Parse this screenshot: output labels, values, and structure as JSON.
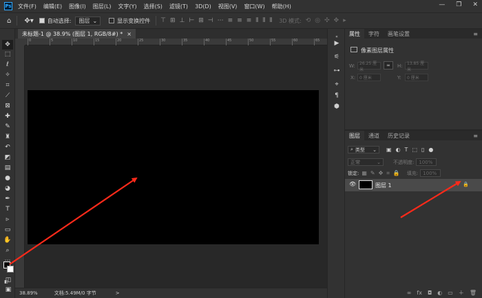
{
  "menubar": {
    "logo": "Ps",
    "items": [
      "文件(F)",
      "编辑(E)",
      "图像(I)",
      "图层(L)",
      "文字(Y)",
      "选择(S)",
      "滤镜(T)",
      "3D(D)",
      "视图(V)",
      "窗口(W)",
      "帮助(H)"
    ],
    "window_controls": [
      "—",
      "❐",
      "✕"
    ]
  },
  "options": {
    "auto_select_label": "自动选择:",
    "auto_select_value": "图层",
    "show_transform_label": "显示变换控件",
    "mode_3d_label": "3D 模式:"
  },
  "document": {
    "tab_title": "未标题-1 @ 38.9% (图层 1, RGB/8#) *",
    "close": "×"
  },
  "ruler": {
    "top_ticks": [
      "0",
      "5",
      "10",
      "15",
      "20",
      "25",
      "30",
      "35",
      "40",
      "45",
      "50",
      "55",
      "60",
      "65"
    ]
  },
  "status": {
    "zoom": "38.89%",
    "doc_info": "文档:5.49M/0 字节",
    "arrow": ">"
  },
  "properties": {
    "tabs": [
      "属性",
      "字符",
      "画笔设置"
    ],
    "section_title": "像素图层属性",
    "w_label": "W:",
    "w_value": "26.25 厘米",
    "h_label": "H:",
    "h_value": "13.85 厘米",
    "x_label": "X:",
    "x_value": "0 厘米",
    "y_label": "Y:",
    "y_value": "0 厘米"
  },
  "layers": {
    "tabs": [
      "图层",
      "通道",
      "历史记录"
    ],
    "filter_kind": "类型",
    "blend_mode": "正常",
    "opacity_label": "不透明度:",
    "opacity_value": "100%",
    "lock_label": "锁定:",
    "fill_label": "填充:",
    "fill_value": "100%",
    "layer_name": "图层 1",
    "footer_icons": [
      "∞",
      "fx",
      "◘",
      "◐",
      "▭",
      "＋",
      "🗑"
    ]
  },
  "colors": {
    "foreground": "#000000",
    "background": "#ffffff",
    "annotation_arrow": "#ff2a1a"
  }
}
